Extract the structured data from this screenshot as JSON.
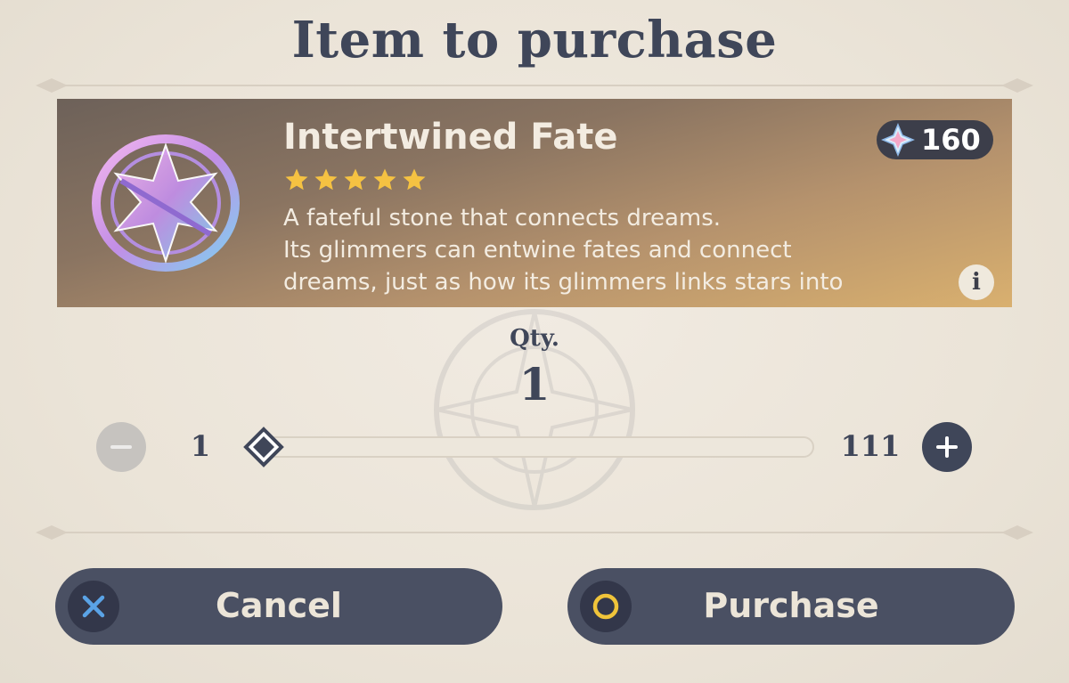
{
  "dialog": {
    "title": "Item to purchase"
  },
  "item": {
    "name": "Intertwined Fate",
    "rarity_stars": 5,
    "price": "160",
    "price_icon": "primogem-icon",
    "description": [
      "A fateful stone that connects dreams.",
      "Its glimmers can entwine fates and connect",
      "dreams, just as how its glimmers links stars into"
    ],
    "info_label": "i"
  },
  "quantity": {
    "label": "Qty.",
    "value": "1",
    "min": "1",
    "max": "111",
    "slider_fraction": 0
  },
  "actions": {
    "cancel_label": "Cancel",
    "purchase_label": "Purchase"
  },
  "colors": {
    "text_dark": "#3f4659",
    "button_bg": "#4a5063",
    "star": "#f5c242",
    "cancel_icon": "#5aa3e6",
    "purchase_icon": "#f0c43a"
  }
}
